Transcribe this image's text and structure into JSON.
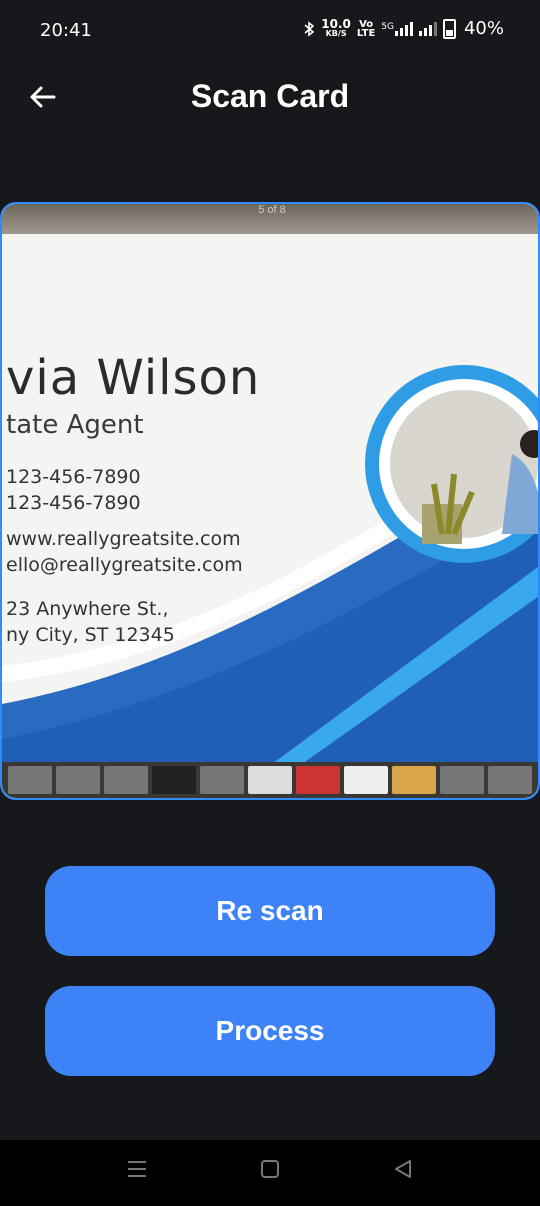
{
  "status_bar": {
    "time": "20:41",
    "net_speed_top": "10.0",
    "net_speed_bottom": "KB/S",
    "vo_top": "Vo",
    "vo_bottom": "LTE",
    "net_type": "5G",
    "battery": "40%"
  },
  "header": {
    "title": "Scan Card",
    "back_icon": "arrow-left-icon"
  },
  "preview": {
    "page_indicator": "5 of 8",
    "name": "via Wilson",
    "role": "tate Agent",
    "phone_1": "123-456-7890",
    "phone_2": "123-456-7890",
    "website": "www.reallygreatsite.com",
    "email": "ello@reallygreatsite.com",
    "address_1": "23 Anywhere St.,",
    "address_2": "ny City, ST 12345"
  },
  "buttons": {
    "rescan_label": "Re scan",
    "process_label": "Process"
  },
  "colors": {
    "background": "#17181c",
    "accent": "#3d82f7",
    "preview_border": "#2f8cff"
  },
  "nav_bar": {
    "menu_icon": "menu-icon",
    "home_icon": "home-square-icon",
    "back_icon": "back-triangle-icon"
  }
}
